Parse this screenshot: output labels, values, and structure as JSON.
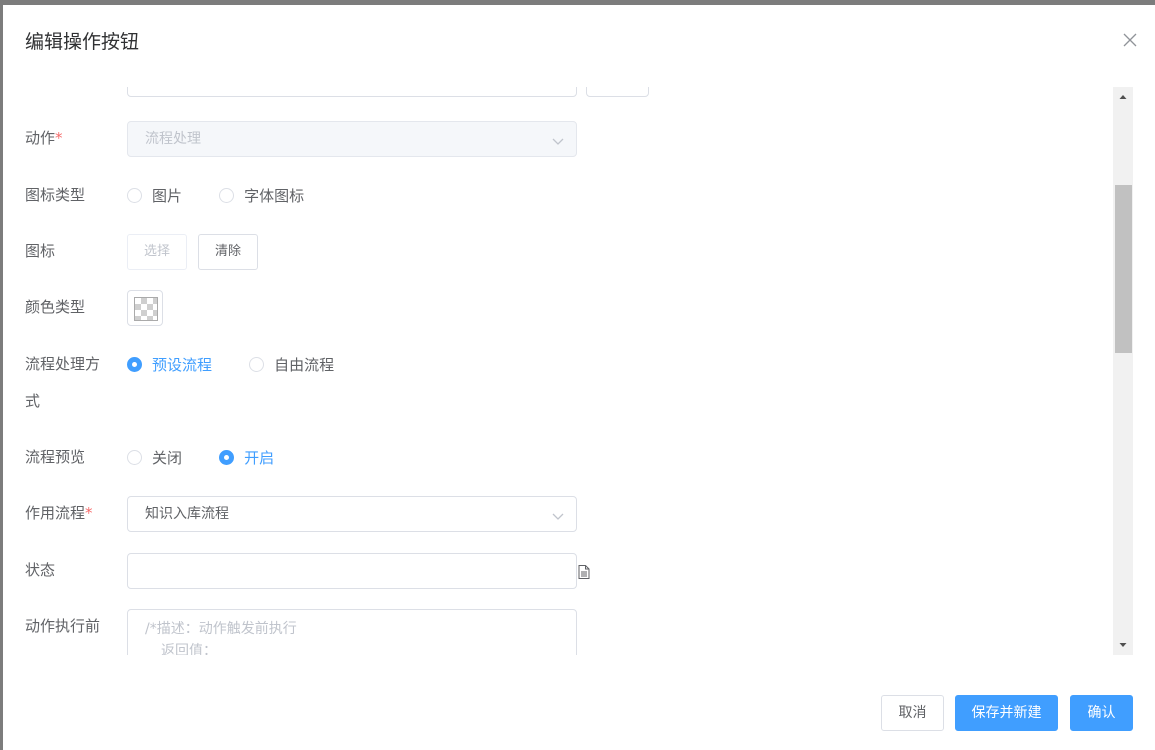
{
  "dialog": {
    "title": "编辑操作按钮"
  },
  "form": {
    "action": {
      "label": "动作",
      "required_mark": "*",
      "value": "流程处理"
    },
    "icon_type": {
      "label": "图标类型",
      "options": [
        "图片",
        "字体图标"
      ]
    },
    "icon": {
      "label": "图标",
      "select_label": "选择",
      "clear_label": "清除"
    },
    "color_type": {
      "label": "颜色类型"
    },
    "flow_mode": {
      "label_line1": "流程处理方",
      "label_line2": "式",
      "options": [
        "预设流程",
        "自由流程"
      ],
      "selected": "预设流程"
    },
    "flow_preview": {
      "label": "流程预览",
      "options": [
        "关闭",
        "开启"
      ],
      "selected": "开启"
    },
    "target_flow": {
      "label": "作用流程",
      "required_mark": "*",
      "value": "知识入库流程"
    },
    "status": {
      "label": "状态",
      "value": ""
    },
    "before_action": {
      "label": "动作执行前",
      "line1": "/*描述：动作触发前执行",
      "line2": "返回值："
    }
  },
  "footer": {
    "cancel": "取消",
    "save_new": "保存并新建",
    "confirm": "确认"
  },
  "colors": {
    "primary": "#409eff",
    "required": "#f56c6c"
  }
}
